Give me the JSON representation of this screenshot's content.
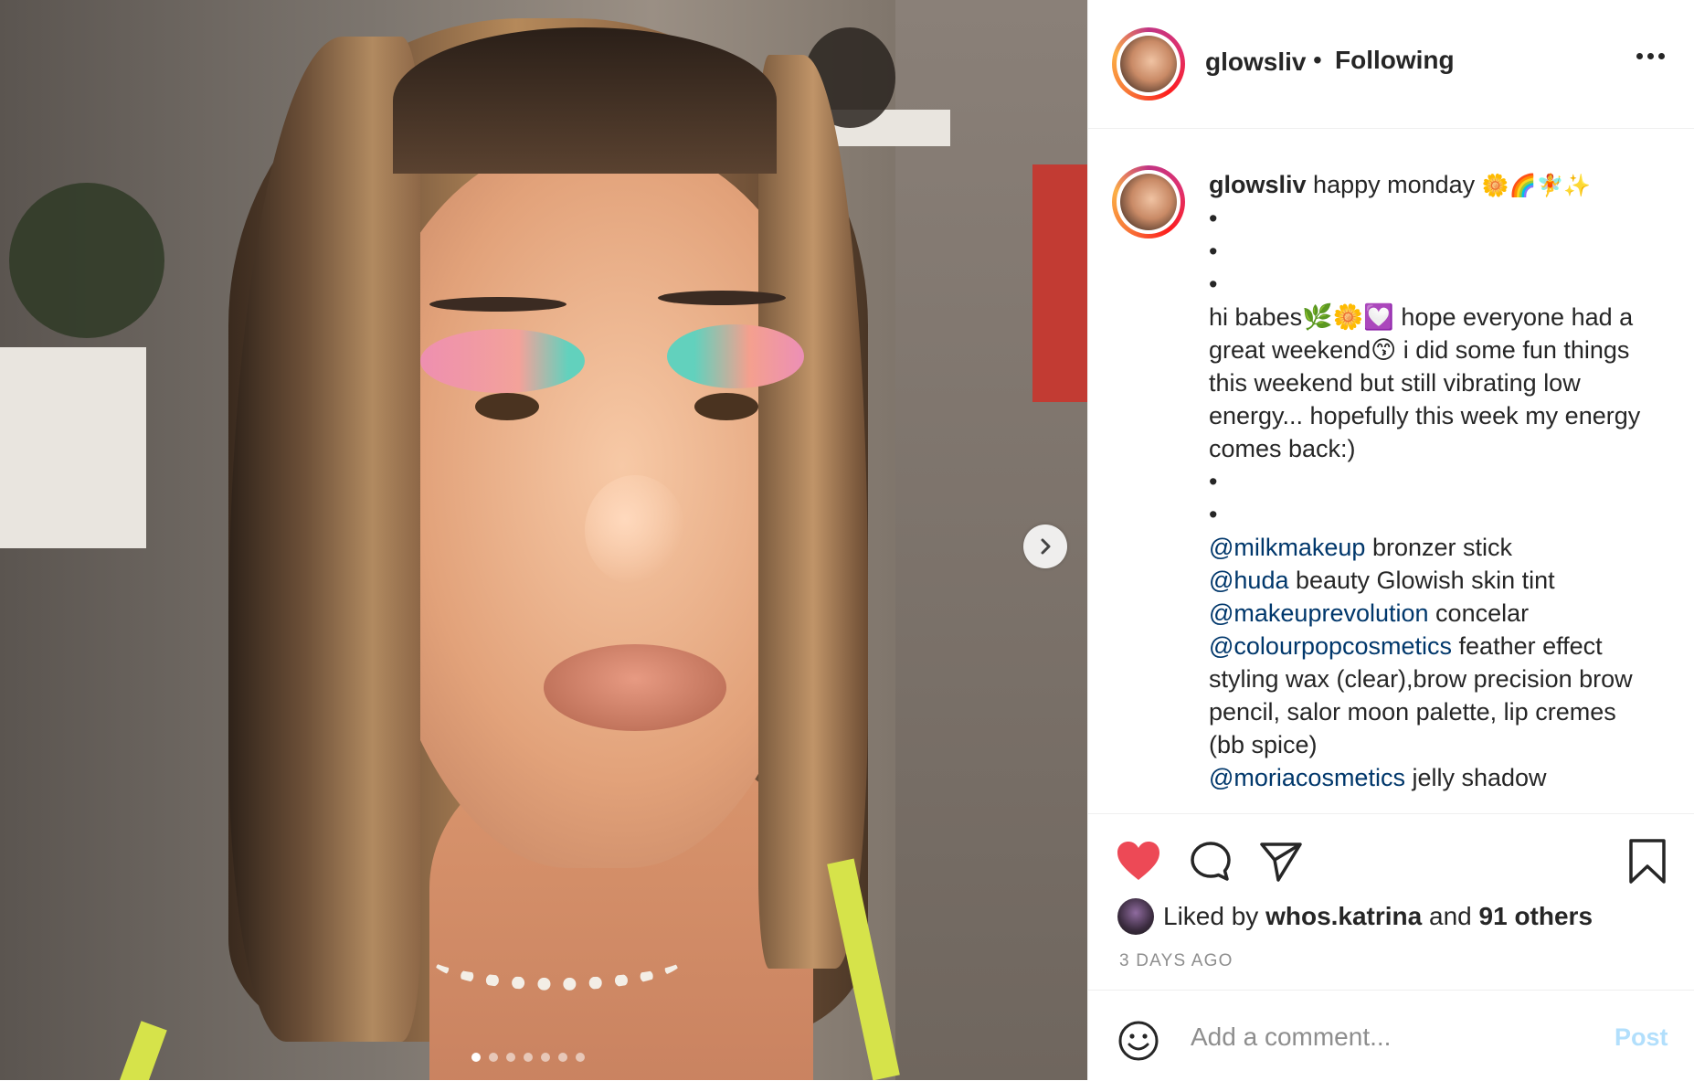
{
  "post": {
    "carousel_total": 7,
    "carousel_index": 1
  },
  "header": {
    "username": "glowsliv",
    "separator": "•",
    "follow_status": "Following"
  },
  "caption": {
    "username": "glowsliv",
    "first_line": "happy monday",
    "first_line_emoji": "🌼🌈🧚✨",
    "lines": [
      "•",
      "•",
      "•",
      "hi babes🌿🌼💟 hope everyone had a",
      "great weekend😙 i did some fun things",
      "this weekend but still vibrating low",
      "energy... hopefully this week my energy",
      "comes back:)",
      "•",
      "•"
    ],
    "mention_lines": [
      {
        "mention": "@milkmakeup",
        "text": " bronzer stick"
      },
      {
        "mention": "@huda",
        "text": " beauty Glowish skin tint"
      },
      {
        "mention": "@makeuprevolution",
        "text": " concelar"
      },
      {
        "mention": "@colourpopcosmetics",
        "text": " feather effect"
      }
    ],
    "continuation_lines": [
      "styling wax (clear),brow precision brow",
      "pencil, salor moon palette, lip cremes",
      "(bb spice)"
    ],
    "last_mention": {
      "mention": "@moriacosmetics",
      "text": " jelly shadow"
    }
  },
  "actions": {
    "liked_by_prefix": "Liked by",
    "liked_by_user": "whos.katrina",
    "liked_by_and": "and",
    "liked_by_others": "91 others",
    "timestamp": "3 DAYS AGO",
    "like_color": "#ed4956"
  },
  "comment": {
    "placeholder": "Add a comment...",
    "post_label": "Post"
  },
  "icons": {
    "like": "heart-filled-icon",
    "comment": "comment-bubble-icon",
    "share": "paper-plane-icon",
    "save": "bookmark-icon",
    "more": "ellipsis-icon",
    "emoji": "smiley-icon",
    "next": "chevron-right-icon"
  }
}
